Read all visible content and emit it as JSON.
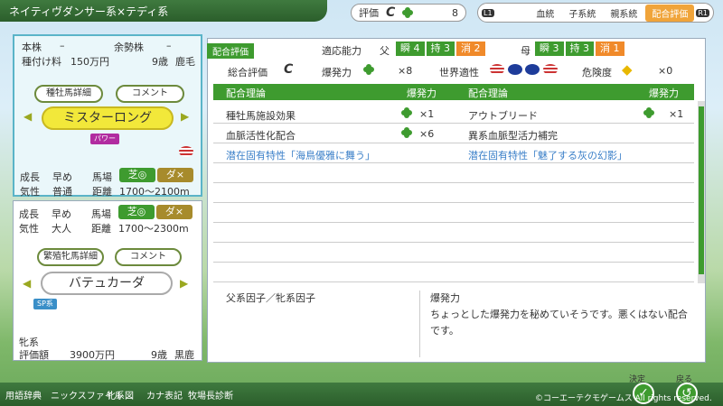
{
  "title": "ネイティヴダンサー系×テディ系",
  "eval": {
    "label": "評価",
    "grade": "C",
    "count": "8"
  },
  "tabs": {
    "l": "L1",
    "items": [
      "血統",
      "子系統",
      "親系統",
      "配合評価"
    ],
    "r": "R1"
  },
  "sire": {
    "line1_a": "本株",
    "line1_b": "–",
    "line1_c": "余勢株",
    "line1_d": "–",
    "fee_label": "種付け料",
    "fee": "150万円",
    "age": "9歳",
    "coat": "鹿毛",
    "detail_btn": "種牡馬詳細",
    "comment_btn": "コメント",
    "name": "ミスターロング",
    "type_tag": "パワー",
    "grow_label": "成長",
    "grow": "早め",
    "track_label": "馬場",
    "turf": "芝◎",
    "dirt": "ダ×",
    "temper_label": "気性",
    "temper": "普通",
    "dist_label": "距離",
    "dist": "1700〜2100m"
  },
  "dam": {
    "grow_label": "成長",
    "grow": "早め",
    "track_label": "馬場",
    "turf": "芝◎",
    "dirt": "ダ×",
    "temper_label": "気性",
    "temper": "大人",
    "dist_label": "距離",
    "dist": "1700〜2300m",
    "detail_btn": "繁殖牝馬詳細",
    "comment_btn": "コメント",
    "name": "バテュカーダ",
    "type_tag": "SP系",
    "line_label": "牝系",
    "value_label": "評価額",
    "value": "3900万円",
    "age": "9歳",
    "coat": "黒鹿"
  },
  "main": {
    "header_tag": "配合評価",
    "aptitude": "適応能力",
    "sire_label": "父",
    "dam_label": "母",
    "sire_stats": [
      "瞬 4",
      "持 3",
      "消 2"
    ],
    "dam_stats": [
      "瞬 3",
      "持 3",
      "消 1"
    ],
    "overall_label": "総合評価",
    "overall": "C",
    "burst_label": "爆発力",
    "burst": "×8",
    "world_label": "世界適性",
    "risk_label": "危険度",
    "risk": "×0",
    "col_theory": "配合理論",
    "col_burst": "爆発力",
    "rows_left": [
      {
        "name": "種牡馬施設効果",
        "val": "×1"
      },
      {
        "name": "血脈活性化配合",
        "val": "×6"
      },
      {
        "name": "潜在固有特性「海鳥優雅に舞う」",
        "val": ""
      }
    ],
    "rows_right": [
      {
        "name": "アウトブリード",
        "val": "×1"
      },
      {
        "name": "異系血脈型活力補完",
        "val": ""
      },
      {
        "name": "潜在固有特性「魅了する灰の幻影」",
        "val": ""
      }
    ],
    "factor_label": "父系因子／牝系因子",
    "desc_title": "爆発力",
    "desc": "ちょっとした爆発力を秘めていそうです。悪くはない配合です。"
  },
  "footer": {
    "items": [
      "用語辞典",
      "ニックスファイル",
      "牝系図",
      "カナ表記",
      "牧場長診断"
    ],
    "ok": "決定",
    "back": "戻る",
    "copyright": "©コーエーテクモゲームス All rights reserved."
  },
  "colors": {
    "accent": "#3e9b2f",
    "tab_active": "#f0a43a",
    "sire_border": "#5ab4c8"
  }
}
